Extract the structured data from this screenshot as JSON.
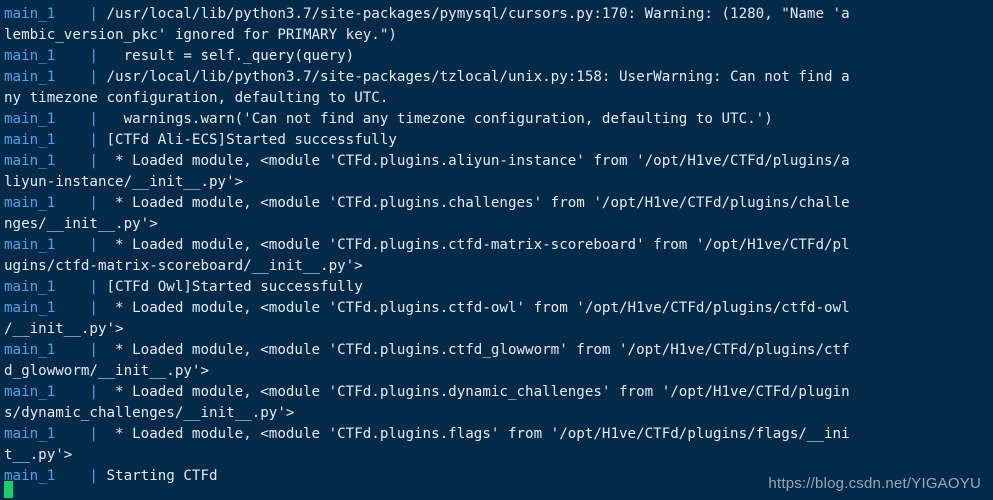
{
  "terminal": {
    "background_color": "#042a4a",
    "text_color": "#e3eaf1",
    "service_color": "#4da3e8",
    "cursor_color": "#13d362",
    "service_name": "main_1",
    "pipe": "|",
    "lines": [
      {
        "type": "entry",
        "service": "main_1",
        "pipe": "|",
        "text": " /usr/local/lib/python3.7/site-packages/pymysql/cursors.py:170: Warning: (1280, \"Name 'a"
      },
      {
        "type": "wrap",
        "text": "lembic_version_pkc' ignored for PRIMARY key.\")"
      },
      {
        "type": "entry",
        "service": "main_1",
        "pipe": "|",
        "text": "   result = self._query(query)"
      },
      {
        "type": "entry",
        "service": "main_1",
        "pipe": "|",
        "text": " /usr/local/lib/python3.7/site-packages/tzlocal/unix.py:158: UserWarning: Can not find a"
      },
      {
        "type": "wrap",
        "text": "ny timezone configuration, defaulting to UTC."
      },
      {
        "type": "entry",
        "service": "main_1",
        "pipe": "|",
        "text": "   warnings.warn('Can not find any timezone configuration, defaulting to UTC.')"
      },
      {
        "type": "entry",
        "service": "main_1",
        "pipe": "|",
        "text": " [CTFd Ali-ECS]Started successfully"
      },
      {
        "type": "entry",
        "service": "main_1",
        "pipe": "|",
        "text": "  * Loaded module, <module 'CTFd.plugins.aliyun-instance' from '/opt/H1ve/CTFd/plugins/a"
      },
      {
        "type": "wrap",
        "text": "liyun-instance/__init__.py'>"
      },
      {
        "type": "entry",
        "service": "main_1",
        "pipe": "|",
        "text": "  * Loaded module, <module 'CTFd.plugins.challenges' from '/opt/H1ve/CTFd/plugins/challe"
      },
      {
        "type": "wrap",
        "text": "nges/__init__.py'>"
      },
      {
        "type": "entry",
        "service": "main_1",
        "pipe": "|",
        "text": "  * Loaded module, <module 'CTFd.plugins.ctfd-matrix-scoreboard' from '/opt/H1ve/CTFd/pl"
      },
      {
        "type": "wrap",
        "text": "ugins/ctfd-matrix-scoreboard/__init__.py'>"
      },
      {
        "type": "entry",
        "service": "main_1",
        "pipe": "|",
        "text": " [CTFd Owl]Started successfully"
      },
      {
        "type": "entry",
        "service": "main_1",
        "pipe": "|",
        "text": "  * Loaded module, <module 'CTFd.plugins.ctfd-owl' from '/opt/H1ve/CTFd/plugins/ctfd-owl"
      },
      {
        "type": "wrap",
        "text": "/__init__.py'>"
      },
      {
        "type": "entry",
        "service": "main_1",
        "pipe": "|",
        "text": "  * Loaded module, <module 'CTFd.plugins.ctfd_glowworm' from '/opt/H1ve/CTFd/plugins/ctf"
      },
      {
        "type": "wrap",
        "text": "d_glowworm/__init__.py'>"
      },
      {
        "type": "entry",
        "service": "main_1",
        "pipe": "|",
        "text": "  * Loaded module, <module 'CTFd.plugins.dynamic_challenges' from '/opt/H1ve/CTFd/plugin"
      },
      {
        "type": "wrap",
        "text": "s/dynamic_challenges/__init__.py'>"
      },
      {
        "type": "entry",
        "service": "main_1",
        "pipe": "|",
        "text": "  * Loaded module, <module 'CTFd.plugins.flags' from '/opt/H1ve/CTFd/plugins/flags/__ini"
      },
      {
        "type": "wrap",
        "text": "t__.py'>"
      },
      {
        "type": "entry",
        "service": "main_1",
        "pipe": "|",
        "text": " Starting CTFd"
      }
    ]
  },
  "watermark": {
    "text": "https://blog.csdn.net/YIGAOYU"
  }
}
